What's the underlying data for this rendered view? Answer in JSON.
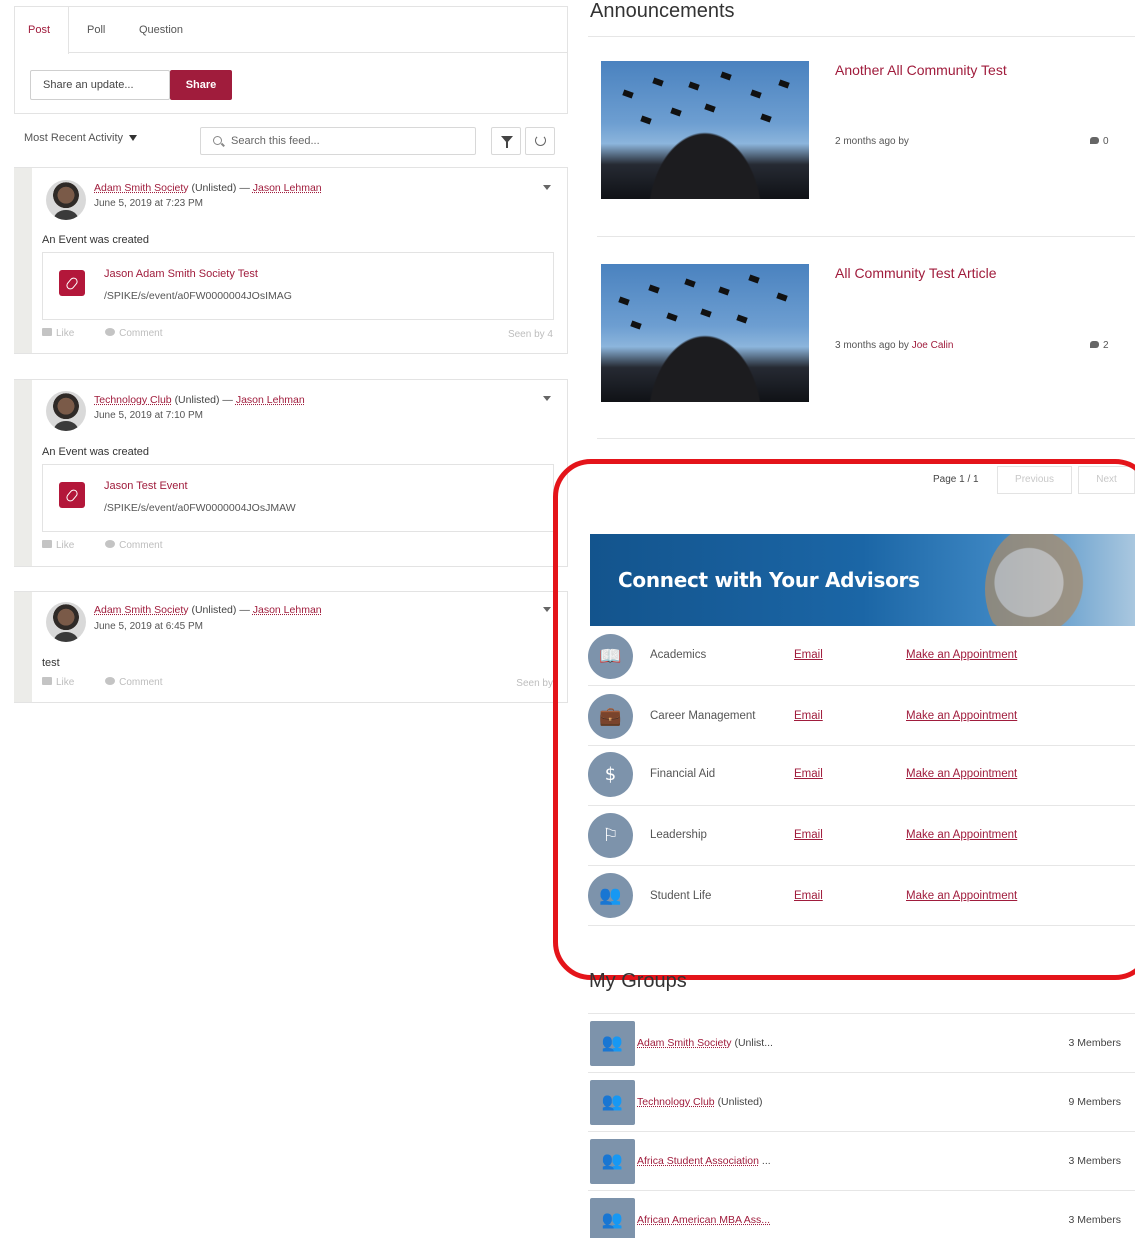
{
  "publisher": {
    "tabs": [
      "Post",
      "Poll",
      "Question"
    ],
    "share_placeholder": "Share an update...",
    "share_button": "Share"
  },
  "feed_toolbar": {
    "sort_label": "Most Recent Activity",
    "search_placeholder": "Search this feed..."
  },
  "feed": [
    {
      "group": "Adam Smith Society",
      "visibility": "(Unlisted)",
      "sep": "—",
      "author": "Jason Lehman",
      "date": "June 5, 2019 at 7:23 PM",
      "body": "An Event was created",
      "card_title": "Jason Adam Smith Society Test",
      "card_url": "/SPIKE/s/event/a0FW0000004JOsIMAG",
      "like": "Like",
      "comment": "Comment",
      "seen": "Seen by 4"
    },
    {
      "group": "Technology Club",
      "visibility": "(Unlisted)",
      "sep": "—",
      "author": "Jason Lehman",
      "date": "June 5, 2019 at 7:10 PM",
      "body": "An Event was created",
      "card_title": "Jason Test Event",
      "card_url": "/SPIKE/s/event/a0FW0000004JOsJMAW",
      "like": "Like",
      "comment": "Comment",
      "seen": ""
    },
    {
      "group": "Adam Smith Society",
      "visibility": "(Unlisted)",
      "sep": "—",
      "author": "Jason Lehman",
      "date": "June 5, 2019 at 6:45 PM",
      "body": "test",
      "like": "Like",
      "comment": "Comment",
      "seen": "Seen by"
    }
  ],
  "announcements": {
    "title": "Announcements",
    "items": [
      {
        "title": "Another All Community Test",
        "meta": "2 months ago by",
        "author": "",
        "count": "0"
      },
      {
        "title": "All Community Test Article",
        "meta": "3 months ago by",
        "author": "Joe Calin",
        "count": "2"
      }
    ],
    "pagination": {
      "label": "Page 1 / 1",
      "previous": "Previous",
      "next": "Next"
    }
  },
  "advisors": {
    "heading": "Connect with Your Advisors",
    "rows": [
      {
        "icon": "book-icon",
        "glyph": "📖",
        "label": "Academics",
        "email": "Email",
        "appointment": "Make an Appointment"
      },
      {
        "icon": "briefcase-icon",
        "glyph": "💼",
        "label": "Career Management",
        "email": "Email",
        "appointment": "Make an Appointment"
      },
      {
        "icon": "dollar-icon",
        "glyph": "$",
        "label": "Financial Aid",
        "email": "Email",
        "appointment": "Make an Appointment"
      },
      {
        "icon": "flag-icon",
        "glyph": "⚐",
        "label": "Leadership",
        "email": "Email",
        "appointment": "Make an Appointment"
      },
      {
        "icon": "people-icon",
        "glyph": "👥",
        "label": "Student Life",
        "email": "Email",
        "appointment": "Make an Appointment"
      }
    ]
  },
  "groups": {
    "title": "My Groups",
    "items": [
      {
        "name": "Adam Smith Society",
        "suffix": "(Unlist...",
        "members": "3 Members"
      },
      {
        "name": "Technology Club",
        "suffix": "(Unlisted)",
        "members": "9 Members"
      },
      {
        "name": "Africa Student Association",
        "suffix": "...",
        "members": "3 Members"
      },
      {
        "name": "African American MBA Ass...",
        "suffix": "",
        "members": "3 Members"
      }
    ]
  },
  "colors": {
    "accent": "#a01c3c",
    "highlight": "#e4141a",
    "icon_bg": "#7d93ab",
    "banner": "#1b66a6"
  }
}
